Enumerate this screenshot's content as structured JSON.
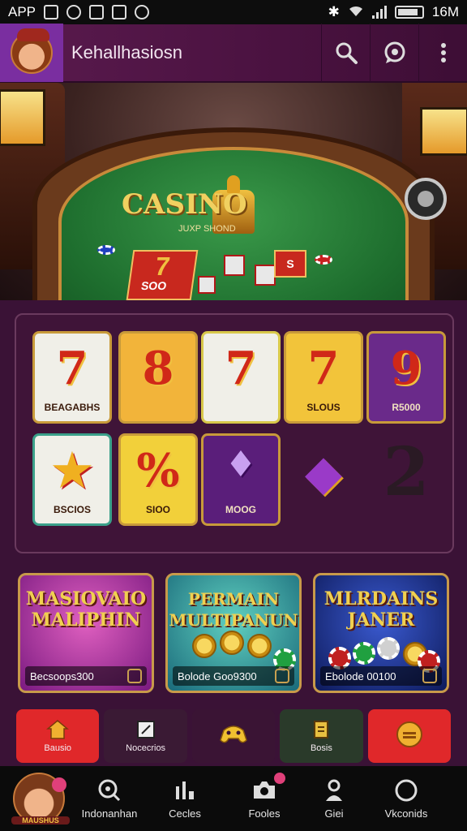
{
  "status_bar": {
    "left_text": "APP",
    "right_text": "16M"
  },
  "header": {
    "title": "Kehallhasiosn",
    "icons": [
      "search-icon",
      "chat-icon",
      "more-vertical-icon"
    ]
  },
  "hero": {
    "casino_title": "CASINO",
    "casino_subtitle": "JUXP SHOND",
    "card_amount": "SOO",
    "card_number": "7",
    "chip_box": "S"
  },
  "games": [
    {
      "symbol": "7",
      "label": "BEAGABHS",
      "bg": "#f0efe8"
    },
    {
      "symbol": "8",
      "label": "",
      "bg": "#f2b43a"
    },
    {
      "symbol": "7",
      "label": "",
      "bg": "#f0efe8"
    },
    {
      "symbol": "7",
      "label": "SLOUS",
      "bg": "#f2c43a"
    },
    {
      "symbol": "9",
      "label": "R5000",
      "bg": "#6a2a8a"
    },
    {
      "symbol": "★",
      "label": "BSCIOS",
      "bg": "#f0efe8"
    },
    {
      "symbol": "%",
      "label": "SIOO",
      "bg": "#f2d03a"
    },
    {
      "symbol": "♦",
      "label": "MOOG",
      "bg": "#5a1e7a"
    },
    {
      "symbol": "◆",
      "label": "",
      "bg": "transparent"
    },
    {
      "symbol": "2",
      "label": "",
      "bg": "transparent"
    }
  ],
  "promos": [
    {
      "title": "MASIOVAIO MALIPHIN",
      "footer": "Becsoops300",
      "accent": "#9a2aa0"
    },
    {
      "title": "PERMAIN MULTIPANUN",
      "footer": "Bolode Goo9300",
      "accent": "#1e9a8a"
    },
    {
      "title": "MLRDAINS JANER",
      "footer": "Ebolode 00100",
      "accent": "#1a3aa0"
    }
  ],
  "quick_actions": [
    {
      "label": "Bausio",
      "icon": "home-icon",
      "color": "#e0282a"
    },
    {
      "label": "Nocecrios",
      "icon": "notepad-icon",
      "color": "#3a1a34"
    },
    {
      "label": "",
      "icon": "controller-icon",
      "color": "#3a1434"
    },
    {
      "label": "Bosis",
      "icon": "document-icon",
      "color": "#2a3a2a"
    },
    {
      "label": "",
      "icon": "coin-icon",
      "color": "#e0282a"
    }
  ],
  "bottom_nav": [
    {
      "label": "MAUSHUS",
      "icon": "profile-avatar"
    },
    {
      "label": "Indonanhan",
      "icon": "search-icon"
    },
    {
      "label": "Cecles",
      "icon": "chart-icon"
    },
    {
      "label": "Fooles",
      "icon": "camera-icon"
    },
    {
      "label": "Giei",
      "icon": "user-icon"
    },
    {
      "label": "Vkconids",
      "icon": "circle-icon"
    }
  ]
}
